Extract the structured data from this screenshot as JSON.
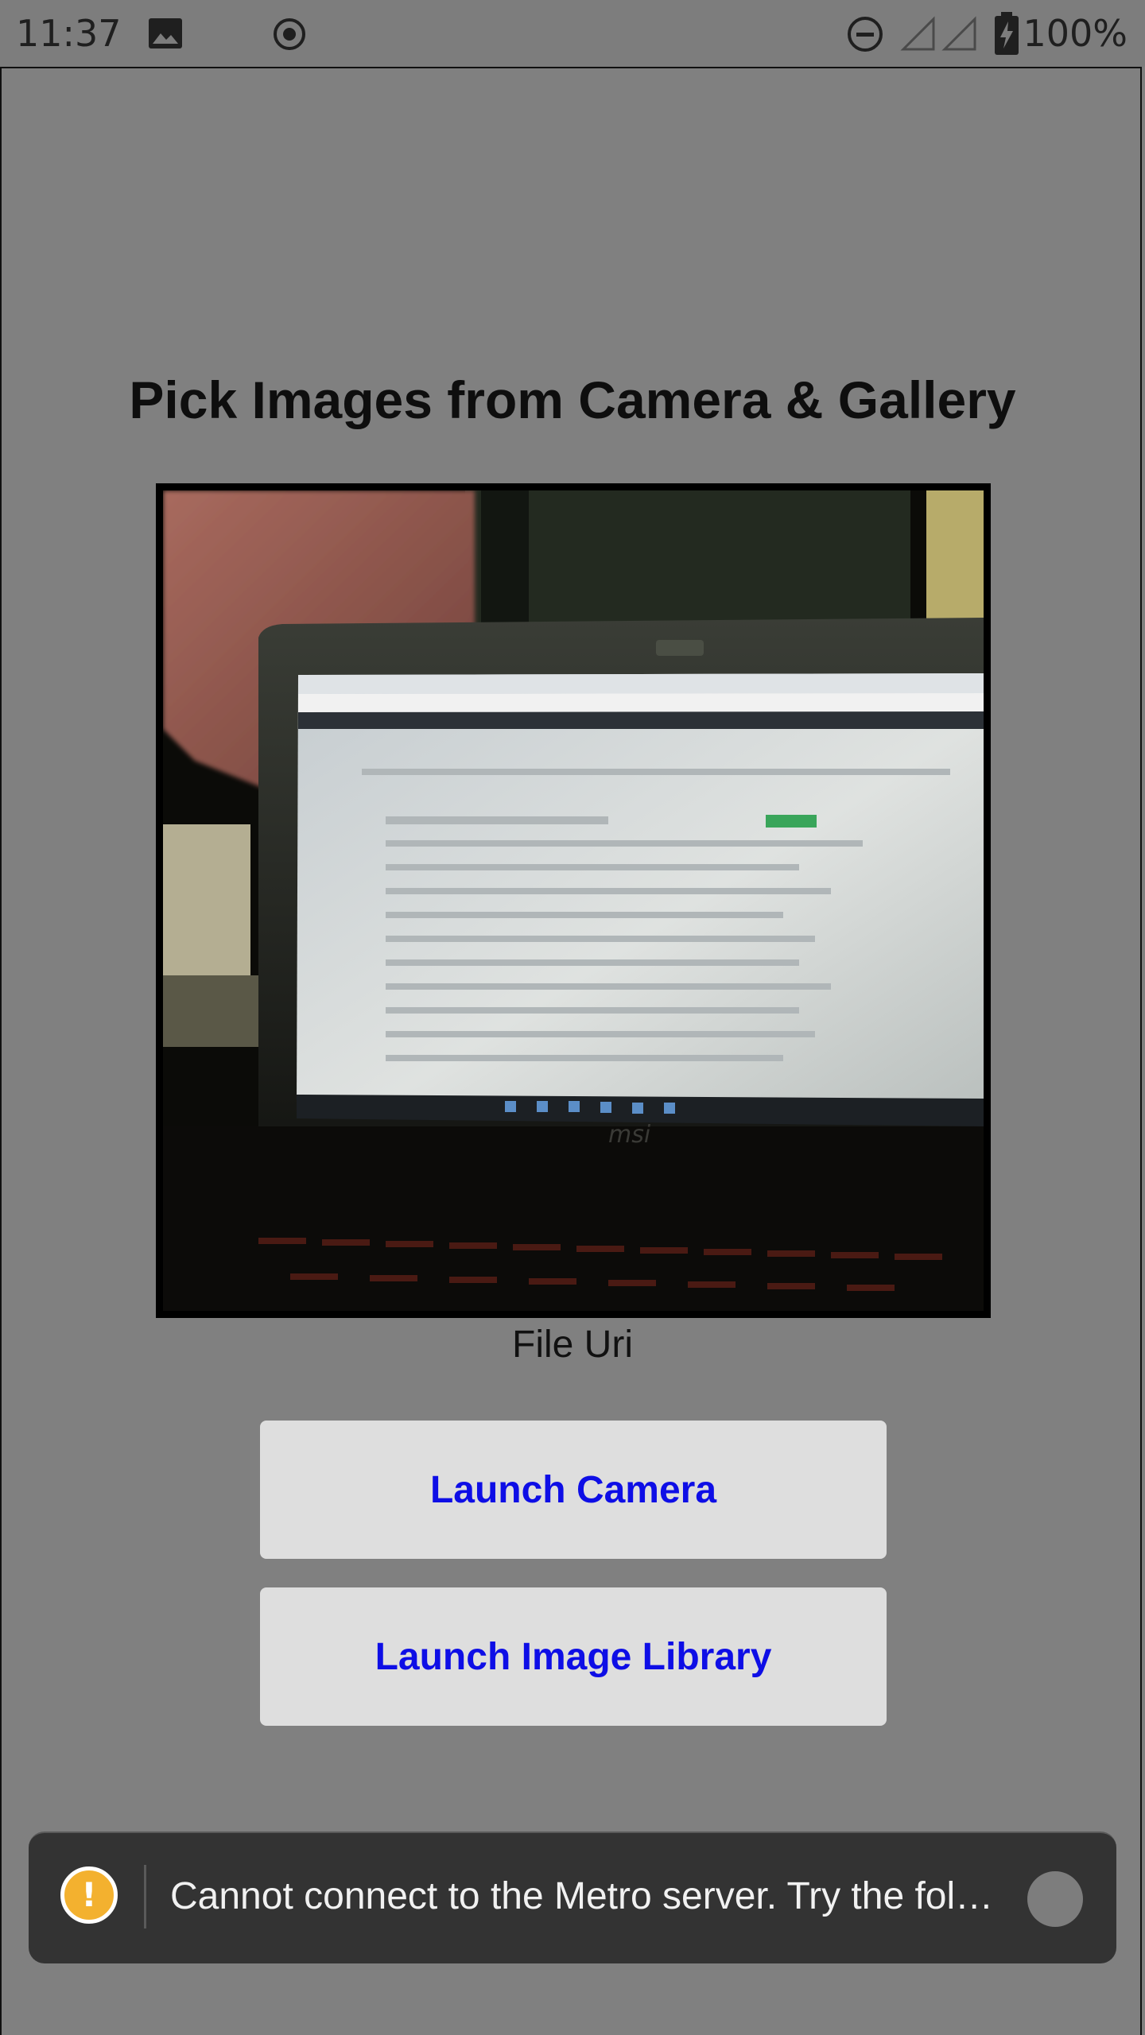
{
  "status_bar": {
    "time": "11:37",
    "battery_percent": "100%",
    "icons": [
      "image-icon",
      "record-icon",
      "do-not-disturb-icon",
      "signal-icon",
      "signal-icon-2",
      "battery-charging-icon"
    ]
  },
  "main": {
    "title": "Pick Images from Camera & Gallery",
    "photo_icon": "photo-thumbnail",
    "file_uri_label": "File Uri",
    "camera_button": "Launch Camera",
    "library_button": "Launch Image Library"
  },
  "toast": {
    "icon": "warning-icon",
    "symbol": "!",
    "message": "Cannot connect to the Metro server.  Try the fol…"
  },
  "colors": {
    "background": "#808080",
    "button_bg": "#dedede",
    "button_text": "#0e0ee6",
    "toast_bg": "#333333",
    "warning": "#f3b12f"
  }
}
